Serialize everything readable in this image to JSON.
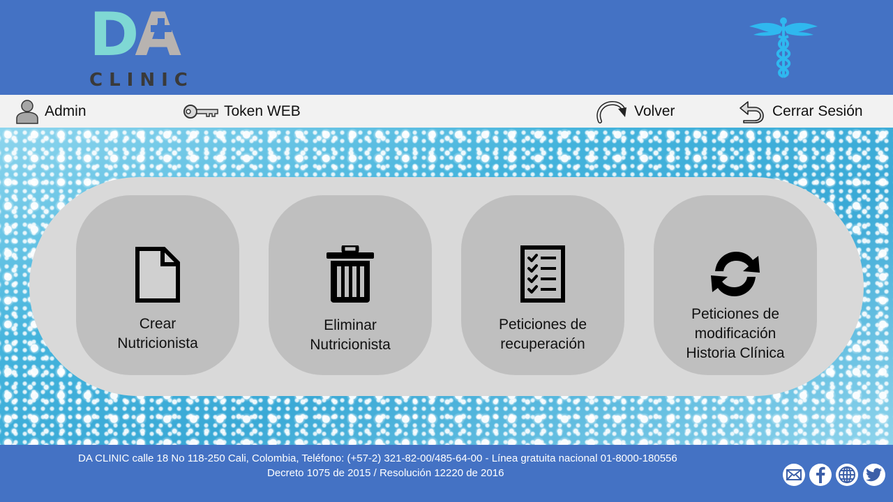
{
  "header": {
    "logo": {
      "letters": "DA",
      "subtitle": "CLINIC",
      "colors": {
        "d": "#7fd8d4",
        "a": "#b8b3b0",
        "plus": "#4472c4",
        "clinic": "#3a3a3a"
      }
    },
    "emblem": "caduceus-icon",
    "background": "#4472c4"
  },
  "toolbar": {
    "admin": {
      "label": "Admin",
      "icon": "user-icon"
    },
    "token": {
      "label": "Token WEB",
      "icon": "key-icon"
    },
    "back": {
      "label": "Volver",
      "icon": "redo-arrow-icon"
    },
    "logout": {
      "label": "Cerrar Sesión",
      "icon": "return-arrow-icon"
    }
  },
  "actions": [
    {
      "label": "Crear\nNutricionista",
      "icon": "document-icon"
    },
    {
      "label": "Eliminar\nNutricionista",
      "icon": "trash-icon"
    },
    {
      "label": "Peticiones de\nrecuperación",
      "icon": "checklist-icon"
    },
    {
      "label": "Peticiones de\nmodificación\nHistoria Clínica",
      "icon": "sync-icon"
    }
  ],
  "footer": {
    "line1": "DA CLINIC calle 18 No 118-250 Cali, Colombia, Teléfono:  (+57-2)  321-82-00/485-64-00 - Línea gratuita nacional  01-8000-180556",
    "line2": "Decreto  1075 de 2015 / Resolución  12220 de 2016",
    "social": [
      "email-icon",
      "facebook-icon",
      "web-globe-icon",
      "twitter-icon"
    ]
  },
  "colors": {
    "accent": "#4472c4",
    "toolbar": "#f2f2f2",
    "panel": "#d9d9d9",
    "card": "#bfbfbf",
    "caduceus": "#2fb8ef"
  }
}
